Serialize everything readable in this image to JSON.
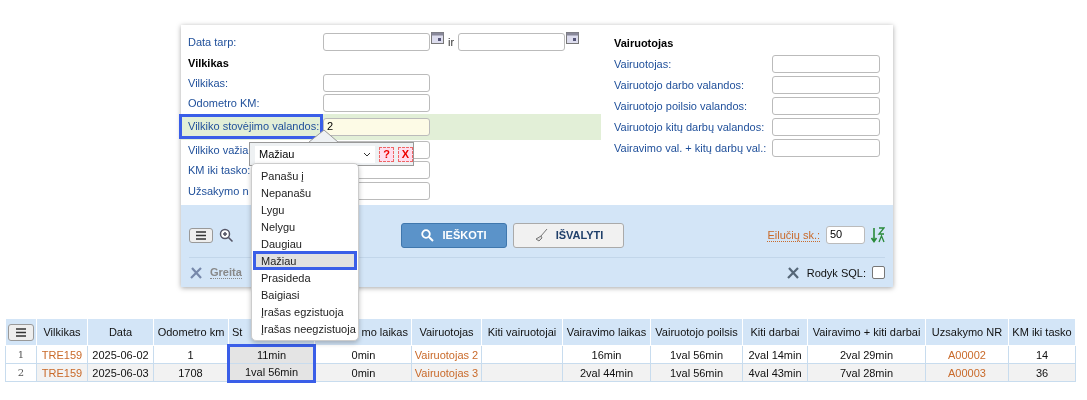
{
  "filter_panel": {
    "left_fields": [
      {
        "kind": "date_range",
        "label": "Data tarp:",
        "separator": "ir"
      },
      {
        "kind": "heading",
        "label": "Vilkikas"
      },
      {
        "kind": "text",
        "label": "Vilkikas:",
        "active": false
      },
      {
        "kind": "text",
        "label": "Odometro KM:",
        "active": false
      },
      {
        "kind": "text",
        "label": "Vilkiko stovėjimo valandos:",
        "value": "2",
        "active": true
      },
      {
        "kind": "text",
        "label": "Vilkiko važia",
        "active": false
      },
      {
        "kind": "text",
        "label": "KM iki tasko:",
        "active": false
      },
      {
        "kind": "text",
        "label": "Užsakymo n",
        "active": false
      }
    ],
    "right_heading": "Vairuotojas",
    "right_fields": [
      {
        "label": "Vairuotojas:"
      },
      {
        "label": "Vairuotojo darbo valandos:"
      },
      {
        "label": "Vairuotojo poilsio valandos:"
      },
      {
        "label": "Vairuotojo kitų darbų valandos:"
      },
      {
        "label": "Vairavimo val. + kitų darbų val.:"
      }
    ]
  },
  "operator_popup": {
    "operator": "Mažiau",
    "help": "?",
    "remove": "X",
    "options": [
      {
        "label": "Panašu į",
        "selected": false
      },
      {
        "label": "Nepanašu",
        "selected": false
      },
      {
        "label": "Lygu",
        "selected": false
      },
      {
        "label": "Nelygu",
        "selected": false
      },
      {
        "label": "Daugiau",
        "selected": false
      },
      {
        "label": "Mažiau",
        "selected": true
      },
      {
        "label": "Prasideda",
        "selected": false
      },
      {
        "label": "Baigiasi",
        "selected": false
      },
      {
        "label": "Įrašas egzistuoja",
        "selected": false
      },
      {
        "label": "Įrašas neegzistuoja",
        "selected": false
      }
    ]
  },
  "toolbar": {
    "search_button": "IEŠKOTI",
    "clear_button": "IŠVALYTI",
    "rows_label": "Eilučių sk.:",
    "rows_value": "50",
    "quick_label": "Greita",
    "sql_label": "Rodyk SQL:",
    "sql_checked": false
  },
  "table": {
    "columns": [
      {
        "label": "Vilkikas",
        "kind": "link",
        "highlighted": false
      },
      {
        "label": "Data",
        "kind": "text",
        "highlighted": false
      },
      {
        "label": "Odometro km",
        "kind": "text",
        "highlighted": false
      },
      {
        "label": "St",
        "kind": "text",
        "highlighted": true
      },
      {
        "label": "mo laikas",
        "kind": "text",
        "highlighted": false
      },
      {
        "label": "Vairuotojas",
        "kind": "link",
        "highlighted": false
      },
      {
        "label": "Kiti vairuotojai",
        "kind": "text",
        "highlighted": false
      },
      {
        "label": "Vairavimo laikas",
        "kind": "text",
        "highlighted": false
      },
      {
        "label": "Vairuotojo poilsis",
        "kind": "text",
        "highlighted": false
      },
      {
        "label": "Kiti darbai",
        "kind": "text",
        "highlighted": false
      },
      {
        "label": "Vairavimo + kiti darbai",
        "kind": "text",
        "highlighted": false
      },
      {
        "label": "Uzsakymo NR",
        "kind": "link",
        "highlighted": false
      },
      {
        "label": "KM iki tasko",
        "kind": "text",
        "highlighted": false
      }
    ],
    "rows": [
      {
        "number": "1",
        "cells": [
          "TRE159",
          "2025-06-02",
          "1",
          "11min",
          "0min",
          "Vairuotojas 2",
          "",
          "16min",
          "1val 56min",
          "2val 14min",
          "2val 29min",
          "A00002",
          "14"
        ]
      },
      {
        "number": "2",
        "cells": [
          "TRE159",
          "2025-06-03",
          "1708",
          "1val 56min",
          "0min",
          "Vairuotojas 3",
          "",
          "2val 44min",
          "1val 56min",
          "4val 43min",
          "7val 28min",
          "A00003",
          "36"
        ]
      }
    ]
  }
}
